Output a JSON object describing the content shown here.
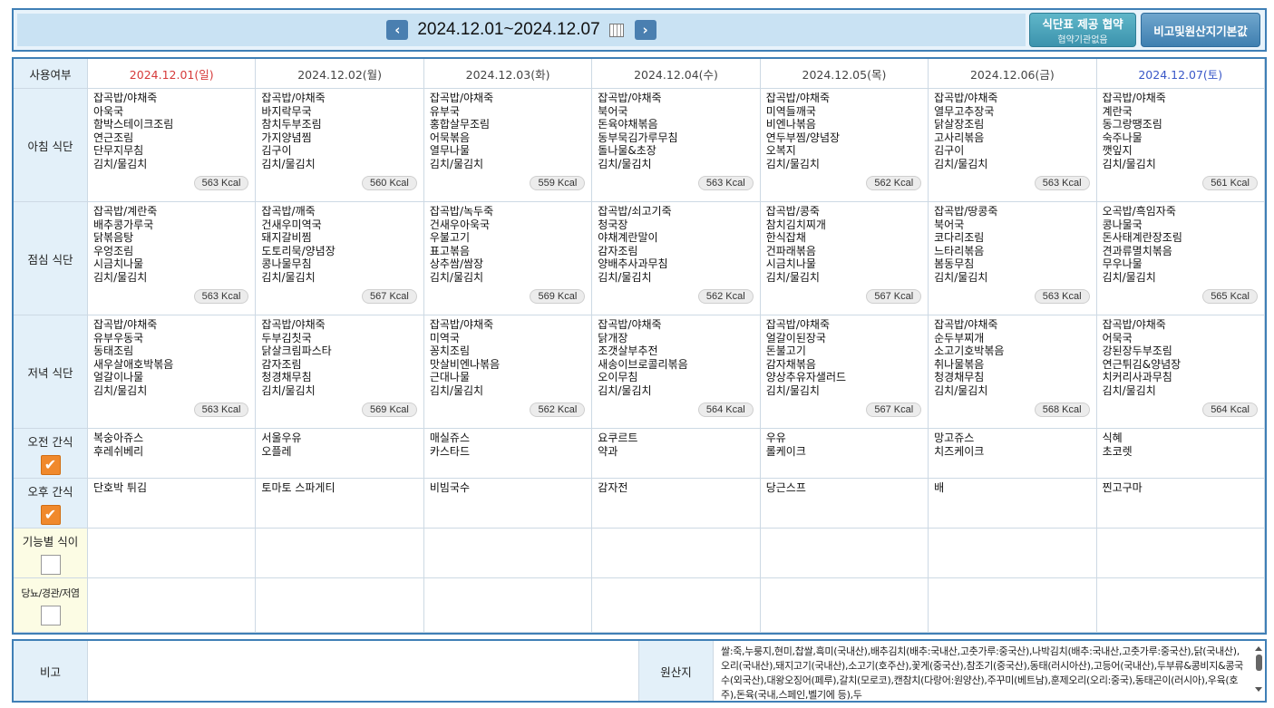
{
  "header": {
    "date_range": "2024.12.01~2024.12.07",
    "btn_agreement": "식단표 제공 협약",
    "btn_agreement_sub": "협약기관없음",
    "btn_remarks": "비고및원산지기본값"
  },
  "grid": {
    "corner_label": "사용여부",
    "days": [
      "2024.12.01(일)",
      "2024.12.02(월)",
      "2024.12.03(화)",
      "2024.12.04(수)",
      "2024.12.05(목)",
      "2024.12.06(금)",
      "2024.12.07(토)"
    ],
    "rows": {
      "breakfast": {
        "label": "아침 식단",
        "menus": [
          "잡곡밥/야채죽\n아욱국\n함박스테이크조림\n연근조림\n단무지무침\n김치/물김치",
          "잡곡밥/야채죽\n바지락무국\n참치두부조림\n가지양념찜\n김구이\n김치/물김치",
          "잡곡밥/야채죽\n유부국\n홍합살무조림\n어묵볶음\n열무나물\n김치/물김치",
          "잡곡밥/야채죽\n북어국\n돈육야채볶음\n동부묵김가루무침\n돌나물&초장\n김치/물김치",
          "잡곡밥/야채죽\n미역들깨국\n비엔나볶음\n연두부찜/양념장\n오복지\n김치/물김치",
          "잡곡밥/야채죽\n열무고추장국\n닭살장조림\n고사리볶음\n김구이\n김치/물김치",
          "잡곡밥/야채죽\n계란국\n동그랑땡조림\n숙주나물\n깻잎지\n김치/물김치"
        ],
        "kcal": [
          "563 Kcal",
          "560 Kcal",
          "559 Kcal",
          "563 Kcal",
          "562 Kcal",
          "563 Kcal",
          "561 Kcal"
        ]
      },
      "lunch": {
        "label": "점심 식단",
        "menus": [
          "잡곡밥/계란죽\n배추콩가루국\n닭볶음탕\n우엉조림\n시금치나물\n김치/물김치",
          "잡곡밥/깨죽\n건새우미역국\n돼지갈비찜\n도토리묵/양념장\n콩나물무침\n김치/물김치",
          "잡곡밥/녹두죽\n건새우아욱국\n우불고기\n표고볶음\n상추쌈/쌈장\n김치/물김치",
          "잡곡밥/쇠고기죽\n청국장\n야채계란말이\n감자조림\n양배추사과무침\n김치/물김치",
          "잡곡밥/콩죽\n참치김치찌개\n한식잡채\n건파래볶음\n시금치나물\n김치/물김치",
          "잡곡밥/땅콩죽\n북어국\n코다리조림\n느타리볶음\n봄동무침\n김치/물김치",
          "오곡밥/흑임자죽\n콩나물국\n돈사태계란장조림\n견과류멸치볶음\n무우나물\n김치/물김치"
        ],
        "kcal": [
          "563 Kcal",
          "567 Kcal",
          "569 Kcal",
          "562 Kcal",
          "567 Kcal",
          "563 Kcal",
          "565 Kcal"
        ]
      },
      "dinner": {
        "label": "저녁 식단",
        "menus": [
          "잡곡밥/야채죽\n유부우동국\n동태조림\n새우살애호박볶음\n얼갈이나물\n김치/물김치",
          "잡곡밥/야채죽\n두부김칫국\n닭살크림파스타\n감자조림\n청경채무침\n김치/물김치",
          "잡곡밥/야채죽\n미역국\n꽁치조림\n맛살비엔나볶음\n근대나물\n김치/물김치",
          "잡곡밥/야채죽\n닭개장\n조갯살부추전\n새송이브로콜리볶음\n오이무침\n김치/물김치",
          "잡곡밥/야채죽\n얼갈이된장국\n돈불고기\n감자채볶음\n양상추유자샐러드\n김치/물김치",
          "잡곡밥/야채죽\n순두부찌개\n소고기호박볶음\n취나물볶음\n청경채무침\n김치/물김치",
          "잡곡밥/야채죽\n어묵국\n강된장두부조림\n연근튀김&양념장\n치커리사과무침\n김치/물김치"
        ],
        "kcal": [
          "563 Kcal",
          "569 Kcal",
          "562 Kcal",
          "564 Kcal",
          "567 Kcal",
          "568 Kcal",
          "564 Kcal"
        ]
      },
      "am_snack": {
        "label": "오전 간식",
        "menus": [
          "복숭아쥬스\n후레쉬베리",
          "서울우유\n오플레",
          "매실쥬스\n카스타드",
          "요쿠르트\n약과",
          "우유\n롤케이크",
          "망고쥬스\n치즈케이크",
          "식혜\n초코렛"
        ]
      },
      "pm_snack": {
        "label": "오후 간식",
        "menus": [
          "단호박 튀김",
          "토마토 스파게티",
          "비빔국수",
          "감자전",
          "당근스프",
          "배",
          "찐고구마"
        ]
      },
      "functional": {
        "label": "기능별 식이"
      },
      "diabetes": {
        "label": "당뇨/경관/저염"
      }
    }
  },
  "footer": {
    "remarks_label": "비고",
    "origin_label": "원산지",
    "origin_text": "쌀:죽,누룽지,현미,찹쌀,흑미(국내산),배추김치(배추:국내산,고춧가루:중국산),나박김치(배추:국내산,고춧가루:중국산),닭(국내산),오리(국내산),돼지고기(국내산),소고기(호주산),꽃게(중국산),참조기(중국산),동태(러시아산),고등어(국내산),두부류&콩비지&콩국수(외국산),대왕오징어(페루),갈치(모로코),캔참치(다랑어:원양산),주꾸미(베트남),훈제오리(오리:중국),동태곤이(러시아),우육(호주),돈육(국내,스페인,벨기에 등),두"
  }
}
